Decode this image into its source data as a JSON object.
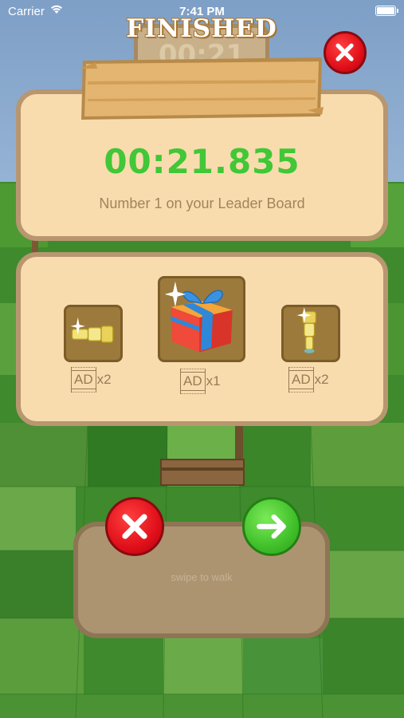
{
  "status_bar": {
    "carrier": "Carrier",
    "time": "7:41 PM"
  },
  "background_timer": "00:21",
  "banner": {
    "title": "FINISHED"
  },
  "result": {
    "time": "00:21.835",
    "message": "Number 1 on your Leader Board"
  },
  "rewards": [
    {
      "name": "spyglass",
      "ad_label": "AD",
      "multiplier": "x2"
    },
    {
      "name": "gift-box",
      "ad_label": "AD",
      "multiplier": "x1"
    },
    {
      "name": "spyglass-vertical",
      "ad_label": "AD",
      "multiplier": "x2"
    }
  ],
  "hint": "swipe to walk",
  "colors": {
    "timer": "#41c737",
    "panel": "#f8dcae",
    "panel_border": "#b89670",
    "close_red": "#e0101a",
    "go_green": "#40c02a"
  },
  "icons": {
    "close": "close-x-icon",
    "next": "arrow-right-icon"
  }
}
